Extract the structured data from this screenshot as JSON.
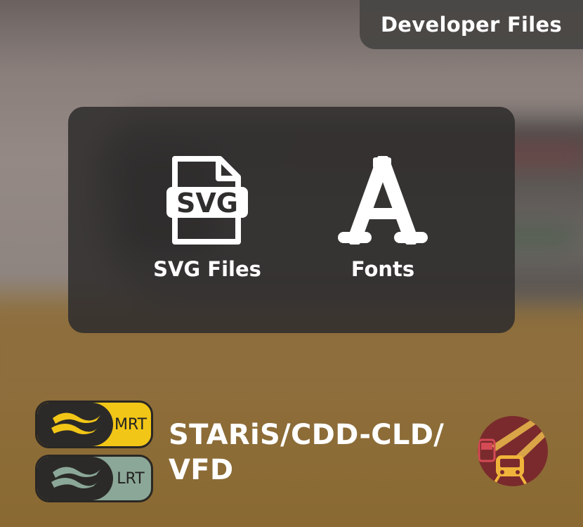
{
  "header": {
    "tab_label": "Developer Files"
  },
  "panel": {
    "items": [
      {
        "label": "SVG Files",
        "icon": "svg-file-icon",
        "icon_text": "SVG"
      },
      {
        "label": "Fonts",
        "icon": "font-letter-a-icon",
        "icon_text": "A"
      }
    ]
  },
  "footer": {
    "mrt_label": "MRT",
    "lrt_label": "LRT",
    "title": "STARiS/CDD-CLD/ VFD",
    "mrt_color": "#f2c617",
    "lrt_color": "#8ba797",
    "badge_icon": "transit-train-bus-icon",
    "badge_color": "#7a2a2c"
  }
}
